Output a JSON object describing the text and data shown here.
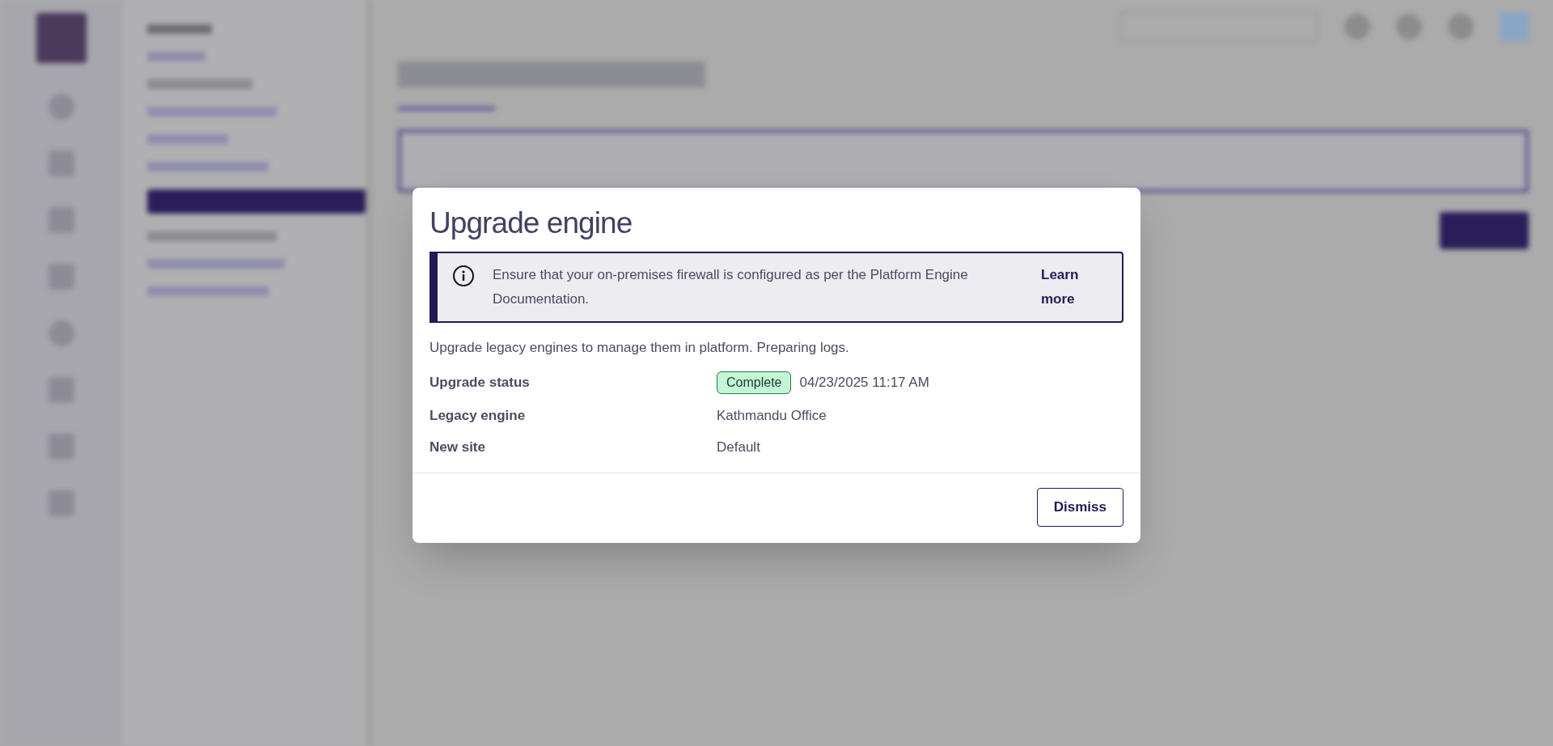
{
  "dialog": {
    "title": "Upgrade engine",
    "alert": {
      "text": "Ensure that your on-premises firewall is configured as per the Platform Engine Documentation.",
      "link": "Learn more"
    },
    "description": "Upgrade legacy engines to manage them in platform. Preparing logs.",
    "details": [
      {
        "label": "Upgrade status",
        "badge": {
          "text": "Complete",
          "kind": "success"
        },
        "value": "04/23/2025 11:17 AM"
      },
      {
        "label": "Legacy engine",
        "value": "Kathmandu Office"
      },
      {
        "label": "New site",
        "value": "Default"
      }
    ],
    "buttons": [
      "Dismiss"
    ]
  }
}
